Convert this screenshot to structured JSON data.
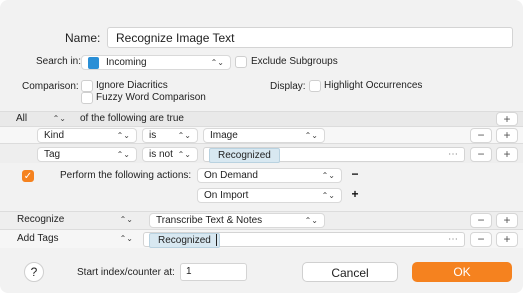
{
  "name": {
    "label": "Name:",
    "value": "Recognize Image Text"
  },
  "search_in": {
    "label": "Search in:",
    "value": "Incoming",
    "exclude_subgroups": "Exclude Subgroups"
  },
  "comparison": {
    "label": "Comparison:",
    "ignore_diacritics": "Ignore Diacritics",
    "fuzzy": "Fuzzy Word Comparison"
  },
  "display": {
    "label": "Display:",
    "highlight": "Highlight Occurrences"
  },
  "match": {
    "mode": "All",
    "suffix": "of the following are true"
  },
  "conditions": [
    {
      "field": "Kind",
      "op": "is",
      "value": "Image"
    },
    {
      "field": "Tag",
      "op": "is not",
      "value": "Recognized"
    }
  ],
  "perform": {
    "label": "Perform the following actions:",
    "options": [
      "On Demand",
      "On Import"
    ]
  },
  "actions": [
    {
      "action": "Recognize",
      "param": "Transcribe Text & Notes"
    },
    {
      "action": "Add Tags",
      "param": "Recognized"
    }
  ],
  "footer": {
    "help": "?",
    "counter_label": "Start index/counter at:",
    "counter_value": "1",
    "cancel": "Cancel",
    "ok": "OK"
  },
  "buttons": {
    "plus": "+",
    "minus": "−",
    "chev": "⌃⌄",
    "ellipsis": "⋯",
    "check": "✓"
  },
  "colors": {
    "accent": "#f5821f",
    "token": "#d8e8f1",
    "folder": "#2a8fd6"
  }
}
